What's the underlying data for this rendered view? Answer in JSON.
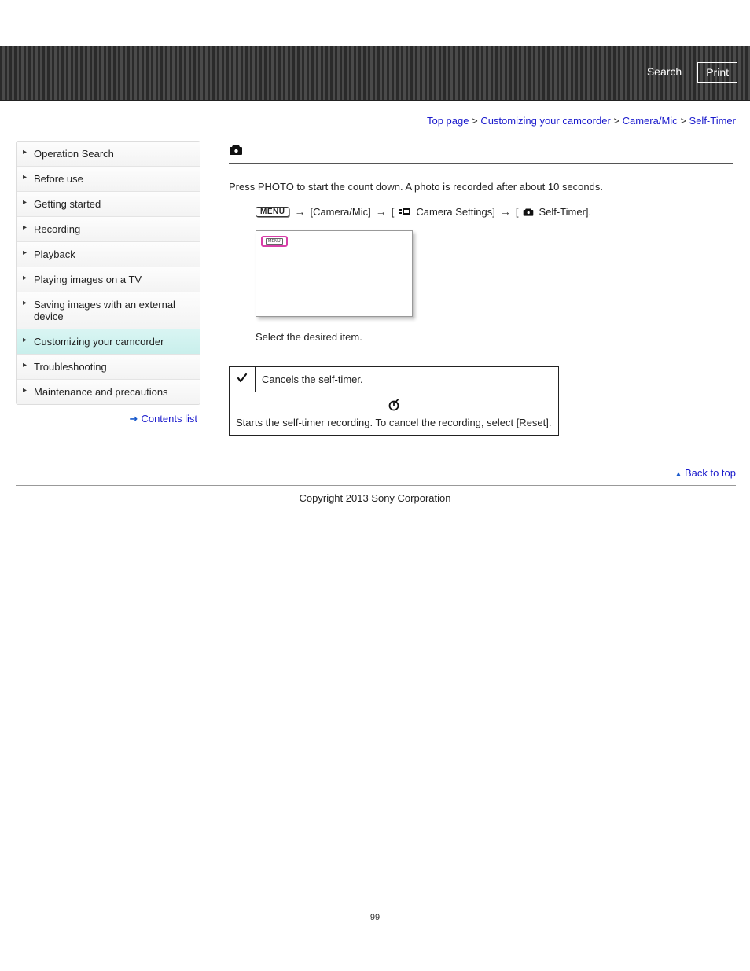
{
  "header": {
    "search_label": "Search",
    "print_label": "Print"
  },
  "breadcrumb": {
    "top": "Top page",
    "customizing": "Customizing your camcorder",
    "camera_mic": "Camera/Mic",
    "current": "Self-Timer"
  },
  "sidebar": {
    "items": [
      "Operation Search",
      "Before use",
      "Getting started",
      "Recording",
      "Playback",
      "Playing images on a TV",
      "Saving images with an external device",
      "Customizing your camcorder",
      "Troubleshooting",
      "Maintenance and precautions"
    ],
    "contents_link": "Contents list"
  },
  "content": {
    "intro": "Press PHOTO to start the count down. A photo is recorded after about 10 seconds.",
    "menu_label": "MENU",
    "path_camera_mic": "[Camera/Mic]",
    "path_camera_settings_prefix": "[",
    "path_camera_settings": "Camera Settings]",
    "path_self_timer_prefix": "[",
    "path_self_timer": "Self-Timer].",
    "step_text": "Select the desired item.",
    "option_off_desc": "Cancels the self-timer.",
    "option_on_desc": "Starts the self-timer recording. To cancel the recording, select [Reset]."
  },
  "footer": {
    "back_to_top": "Back to top",
    "copyright": "Copyright 2013 Sony Corporation",
    "page_number": "99"
  }
}
